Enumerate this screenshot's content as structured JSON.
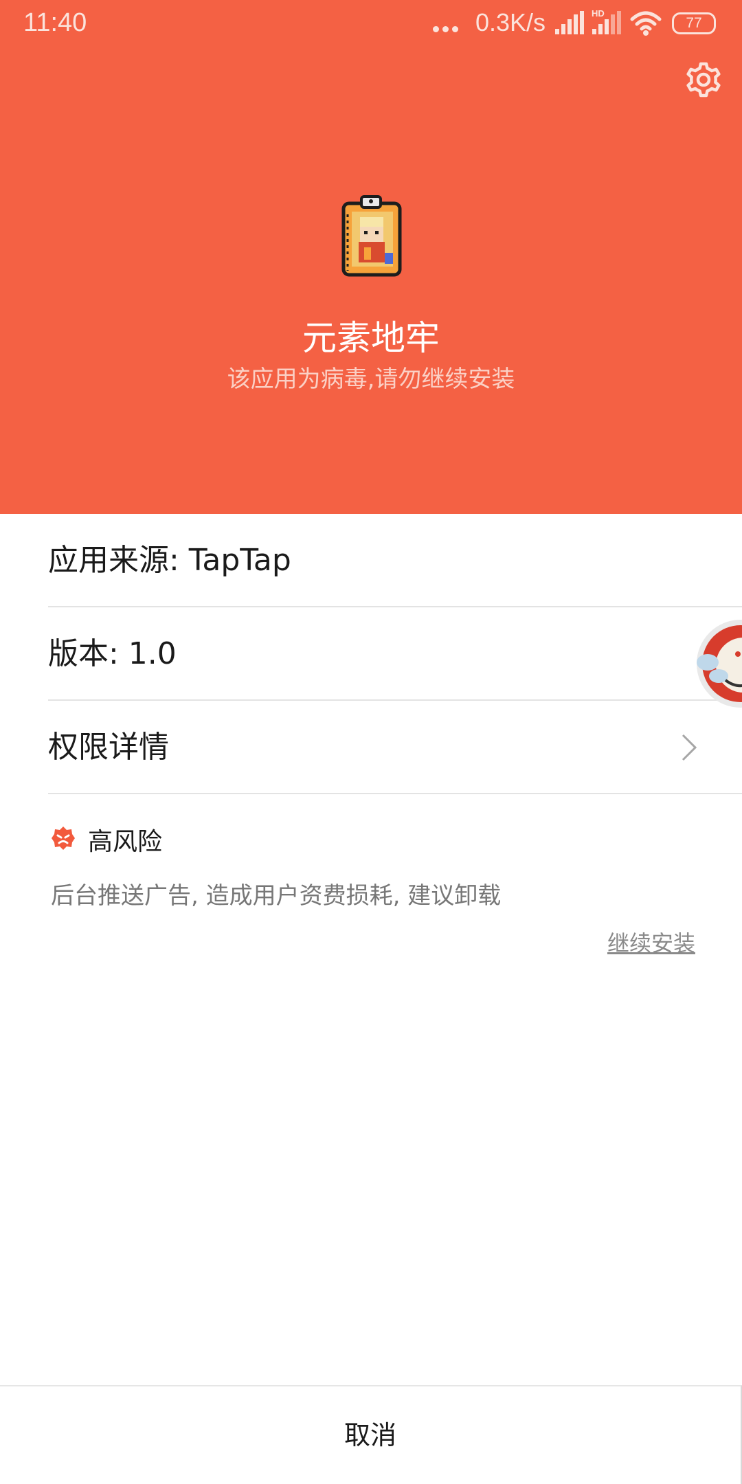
{
  "status_bar": {
    "time": "11:40",
    "network_speed": "0.3K/s",
    "hd_label": "HD",
    "battery_level": "77"
  },
  "header": {
    "background_color": "#f46144",
    "app_name": "元素地牢",
    "warning": "该应用为病毒,请勿继续安装",
    "settings_icon": "gear-icon"
  },
  "details": {
    "source": "应用来源: TapTap",
    "version": "版本: 1.0",
    "permissions_label": "权限详情",
    "permissions_icon": "chevron-right-icon"
  },
  "risk": {
    "level": "高风险",
    "description": "后台推送广告, 造成用户资费损耗, 建议卸载",
    "continue_label": "继续安装",
    "accent_color": "#f25a3d"
  },
  "footer": {
    "cancel_label": "取消"
  }
}
